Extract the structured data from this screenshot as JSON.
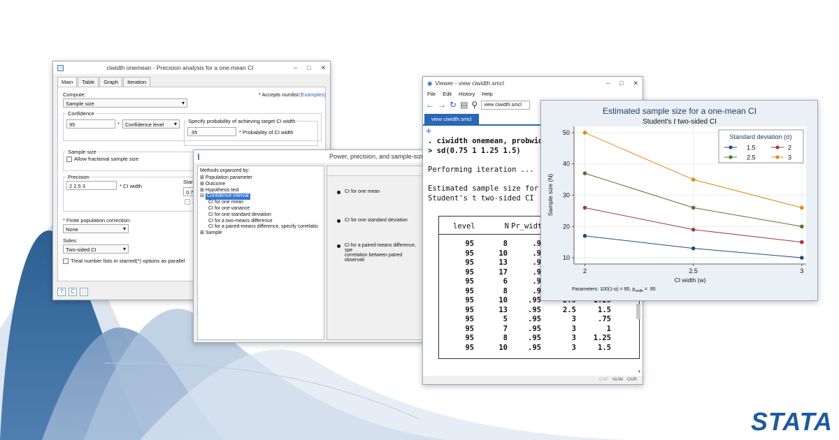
{
  "brand": {
    "logo_text": "STATA",
    "color": "#1e5aa0"
  },
  "dialog1": {
    "title": "ciwidth onemean - Precision analysis for a one-mean CI",
    "tabs": [
      "Main",
      "Table",
      "Graph",
      "Iteration"
    ],
    "compute_label": "Compute:",
    "compute_value": "Sample size",
    "accepts_note": "* Accepts numlist",
    "examples_link": "(Examples)",
    "confidence_group": "Confidence",
    "confidence_value": "95",
    "confidence_star": "*",
    "confidence_dropdown": "Confidence level",
    "prob_label": "Specify probability of achieving target CI width",
    "prob_value": ".95",
    "prob_caption": "* Probability of CI width",
    "sample_size_group": "Sample size",
    "allow_fractional": "Allow fractional sample size",
    "precision_group": "Precision",
    "precision_value": "2 2.5 3",
    "ci_width_caption": "* CI width",
    "stan_partial": "Stan",
    "stan_box_partial": "0.7",
    "a_partial": "A",
    "fpc_label": "* Finite population correction:",
    "fpc_value": "None",
    "sides_label": "Sides:",
    "sides_value": "Two-sided CI",
    "parallel_label": "Treat number lists in starred(*) options as parallel",
    "help_icon": "?",
    "reset_icon": "C"
  },
  "dialog2": {
    "title": "Power, precision, and sample-size",
    "tree_header": "Methods organized by:",
    "tree": [
      {
        "label": "Population parameter",
        "level": 0,
        "prefix": "⊞"
      },
      {
        "label": "Outcome",
        "level": 0,
        "prefix": "⊞"
      },
      {
        "label": "Hypothesis test",
        "level": 0,
        "prefix": "⊞"
      },
      {
        "label": "Confidence interval",
        "level": 0,
        "prefix": "⊟",
        "selected": true
      },
      {
        "label": "CI for one mean",
        "level": 1
      },
      {
        "label": "CI for one variance",
        "level": 1
      },
      {
        "label": "CI for one standard deviation",
        "level": 1
      },
      {
        "label": "CI for a two-means difference",
        "level": 1
      },
      {
        "label": "CI for a paired-means difference, specify correlatio",
        "level": 1
      },
      {
        "label": "Sample",
        "level": 0,
        "prefix": "⊞"
      }
    ],
    "options": [
      "CI for one mean",
      "CI for one standard deviation",
      "CI for a paired-means difference, spe",
      "correlation between paired observati"
    ]
  },
  "viewer": {
    "title": "Viewer - view ciwidth.smcl",
    "menu": [
      "File",
      "Edit",
      "History",
      "Help"
    ],
    "url": "view ciwidth.smcl",
    "tab": "view ciwidth.smcl",
    "cmd1": ". ciwidth onemean, probwidth",
    "cmd2": "> sd(0.75 1 1.25 1.5)",
    "iter": "Performing iteration ...",
    "est1": "Estimated sample size for a",
    "est2": "Student's t two-sided CI",
    "headers": [
      "level",
      "N",
      "Pr_width"
    ],
    "rows": [
      [
        "95",
        "8",
        ".9",
        "",
        ""
      ],
      [
        "95",
        "10",
        ".9",
        "",
        ""
      ],
      [
        "95",
        "13",
        ".9",
        "",
        ""
      ],
      [
        "95",
        "17",
        ".9",
        "",
        ""
      ],
      [
        "95",
        "6",
        ".9",
        "",
        ""
      ],
      [
        "95",
        "8",
        ".9",
        "",
        ""
      ],
      [
        "95",
        "10",
        ".95",
        "2.5",
        "1.25"
      ],
      [
        "95",
        "13",
        ".95",
        "2.5",
        "1.5"
      ],
      [
        "95",
        "5",
        ".95",
        "3",
        ".75"
      ],
      [
        "95",
        "7",
        ".95",
        "3",
        "1"
      ],
      [
        "95",
        "8",
        ".95",
        "3",
        "1.25"
      ],
      [
        "95",
        "10",
        ".95",
        "3",
        "1.5"
      ]
    ],
    "status": [
      "CAP",
      "NUM",
      "OVR"
    ]
  },
  "chart_data": {
    "type": "line",
    "title": "Estimated sample size for a one-mean CI",
    "subtitle_pre": "Student's",
    "subtitle_t": "t",
    "subtitle_post": "two-sided CI",
    "xlabel": "CI width (w)",
    "ylabel": "Sample size (N)",
    "x": [
      2,
      2.5,
      3
    ],
    "xticks": [
      "2",
      "2.5",
      "3"
    ],
    "yticks": [
      10,
      20,
      30,
      40,
      50
    ],
    "ylim": [
      8,
      52
    ],
    "xlim": [
      1.95,
      3.02
    ],
    "legend_title": "Standard deviation (σ)",
    "legend_position": "top-right",
    "series": [
      {
        "name": "1.5",
        "values": [
          17,
          13,
          10
        ],
        "color": "#1f4e79"
      },
      {
        "name": "2",
        "values": [
          26,
          19,
          15
        ],
        "color": "#a23a3a"
      },
      {
        "name": "2.5",
        "values": [
          37,
          26,
          20
        ],
        "color": "#4e7a2c"
      },
      {
        "name": "3",
        "values": [
          50,
          35,
          26
        ],
        "color": "#e8870f"
      }
    ],
    "note": "Parameters: 100(1-α) = 95, p",
    "note_sub": "width",
    "note_post": " = .95"
  }
}
